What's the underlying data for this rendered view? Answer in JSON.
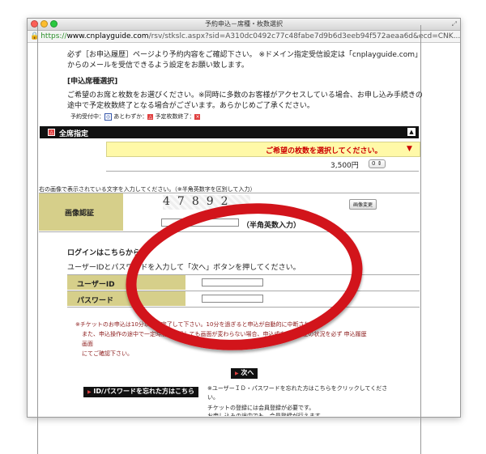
{
  "window": {
    "title": "予約申込－席種・枚数選択",
    "url_scheme": "https://",
    "url_host": "www.cnplayguide.com",
    "url_path": "/rsv/stkslc.aspx?sid=A310dc0492c77c48fabe7d9b6d3eeb94f572aeaa6d&ecd=CNK..."
  },
  "notice": {
    "line1": "必ず［お申込履歴］ページより予約内容をご確認下さい。 ※ドメイン指定受信設定は「cnplayguide.com」",
    "line2": "からのメールを受信できるよう設定をお願い致します。"
  },
  "seat_section": {
    "heading": "[申込席種選択]",
    "desc1": "ご希望のお席と枚数をお選びください。※同時に多数のお客様がアクセスしている場合、お申し込み手続きの",
    "desc2": "途中で予定枚数終了となる場合がございます。あらかじめご了承ください。",
    "legend_available": "予約受付中：",
    "legend_few": "あとわずか：",
    "legend_soldout": "予定枚数終了："
  },
  "seat_bar": {
    "label": "全席指定"
  },
  "seat_select": {
    "prompt": "ご希望の枚数を選択してください。",
    "price": "3,500円",
    "quantity": "0"
  },
  "captcha": {
    "instruction": "右の画像で表示されている文字を入力してください。（※半角英数字を区別して入力）",
    "row_label": "画像認証",
    "image_text": "47892",
    "change_button": "画像変更",
    "input_hint": "（半角英数入力）"
  },
  "login": {
    "heading": "ログインはこちらから]",
    "desc": "ユーザーIDとパスワードを入力して「次へ」ボタンを押してください。",
    "user_label": "ユーザーID",
    "password_label": "パスワード"
  },
  "warning": {
    "line1": "※チケットのお申込は10分以内に完了して下さい。10分を過ぎると申込が自動的に中断されます。",
    "line2": "また、申込操作の途中で一定時間が経過しても画面が変わらない場合、申込成立・不成立の状況を必ず 申込履歴",
    "line3": "画面",
    "line4": "にてご確認下さい。"
  },
  "next_button": {
    "label": "次へ"
  },
  "forgot": {
    "button": "ID/パスワードを忘れた方はこちら",
    "note1": "※ユーザーＩＤ・パスワードを忘れた方はこちらをクリックしてくださ",
    "note2": "い。",
    "note3": "チケットの登録には会員登録が必要です。",
    "note4": "お申し込みの途中でも、会員登録が行えます。"
  },
  "colors": {
    "highlight_red": "#d2141b",
    "header_bg": "#111111",
    "yellow_box": "#fff9a8",
    "olive_cell": "#d6cf8a"
  }
}
